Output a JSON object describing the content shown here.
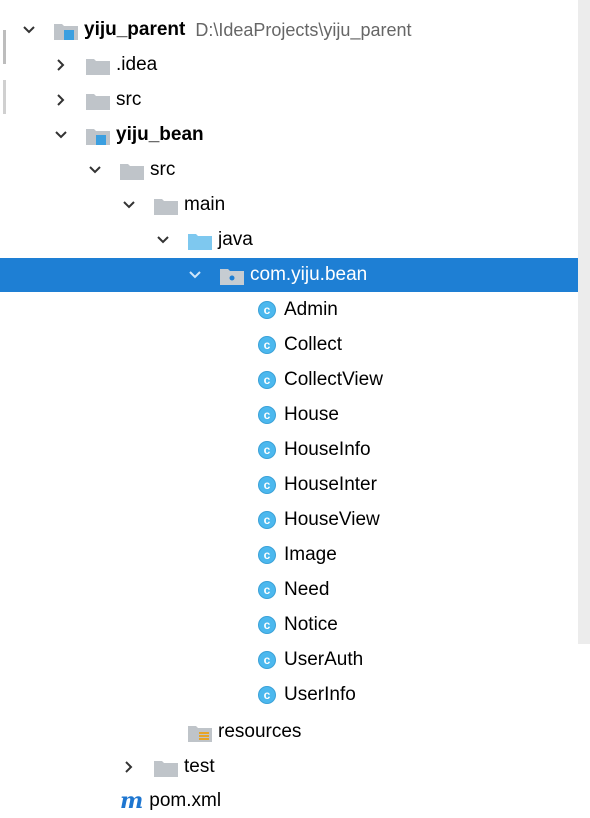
{
  "project": {
    "name": "yiju_parent",
    "path": "D:\\IdeaProjects\\yiju_parent"
  },
  "nodes": {
    "idea": ".idea",
    "src_root": "src",
    "module": "yiju_bean",
    "module_src": "src",
    "main": "main",
    "java": "java",
    "package": "com.yiju.bean",
    "resources": "resources",
    "test": "test",
    "pom": "pom.xml"
  },
  "classes": [
    "Admin",
    "Collect",
    "CollectView",
    "House",
    "HouseInfo",
    "HouseInter",
    "HouseView",
    "Image",
    "Need",
    "Notice",
    "UserAuth",
    "UserInfo"
  ],
  "class_icon_letter": "c",
  "maven_icon_letter": "m",
  "colors": {
    "selection": "#1e7fd4",
    "folder_gray": "#bfc4c9",
    "folder_blue": "#7ec8ef",
    "class_icon": "#4cb8ee"
  }
}
